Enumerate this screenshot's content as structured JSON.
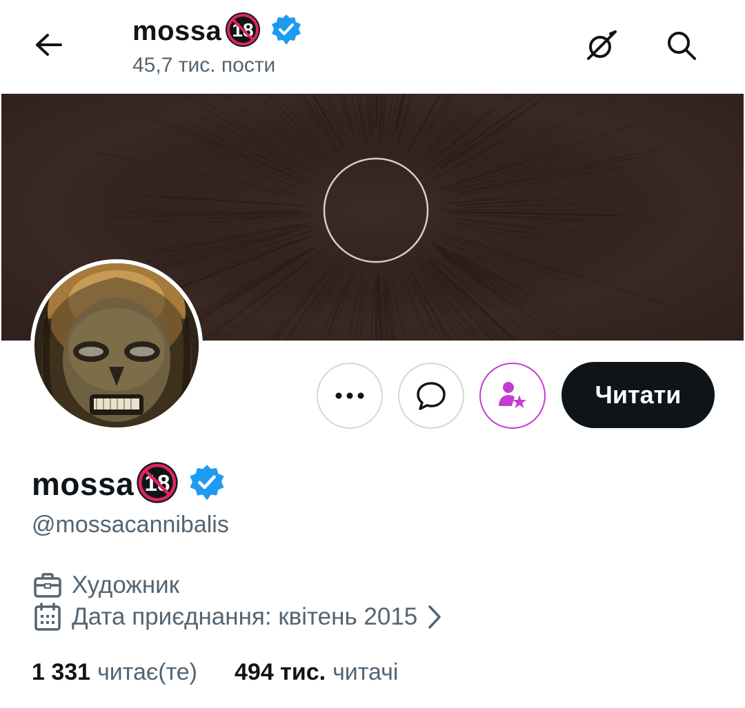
{
  "header": {
    "name": "mossa",
    "badge_text": "18",
    "posts_count": "45,7 тис. пости"
  },
  "icons": {
    "back": "arrow-left-icon",
    "grok": "grok-icon",
    "search": "search-icon",
    "more": "more-horizontal-icon",
    "message": "message-icon",
    "subscribe": "subscribe-star-icon",
    "verified": "verified-badge-icon",
    "briefcase": "briefcase-icon",
    "calendar": "calendar-icon",
    "chevron": "chevron-right-icon"
  },
  "actions": {
    "follow_label": "Читати"
  },
  "profile": {
    "name": "mossa",
    "badge_text": "18",
    "handle": "@mossacannibalis",
    "profession": "Художник",
    "joined": "Дата приєднання: квітень 2015"
  },
  "stats": {
    "following_count": "1 331",
    "following_label": "читає(те)",
    "followers_count": "494 тис.",
    "followers_label": "читачі"
  },
  "colors": {
    "accent_verified": "#1d9bf0",
    "subscribe_purple": "#c23cd3",
    "follow_button_bg": "#0f1419",
    "secondary_text": "#536471"
  }
}
